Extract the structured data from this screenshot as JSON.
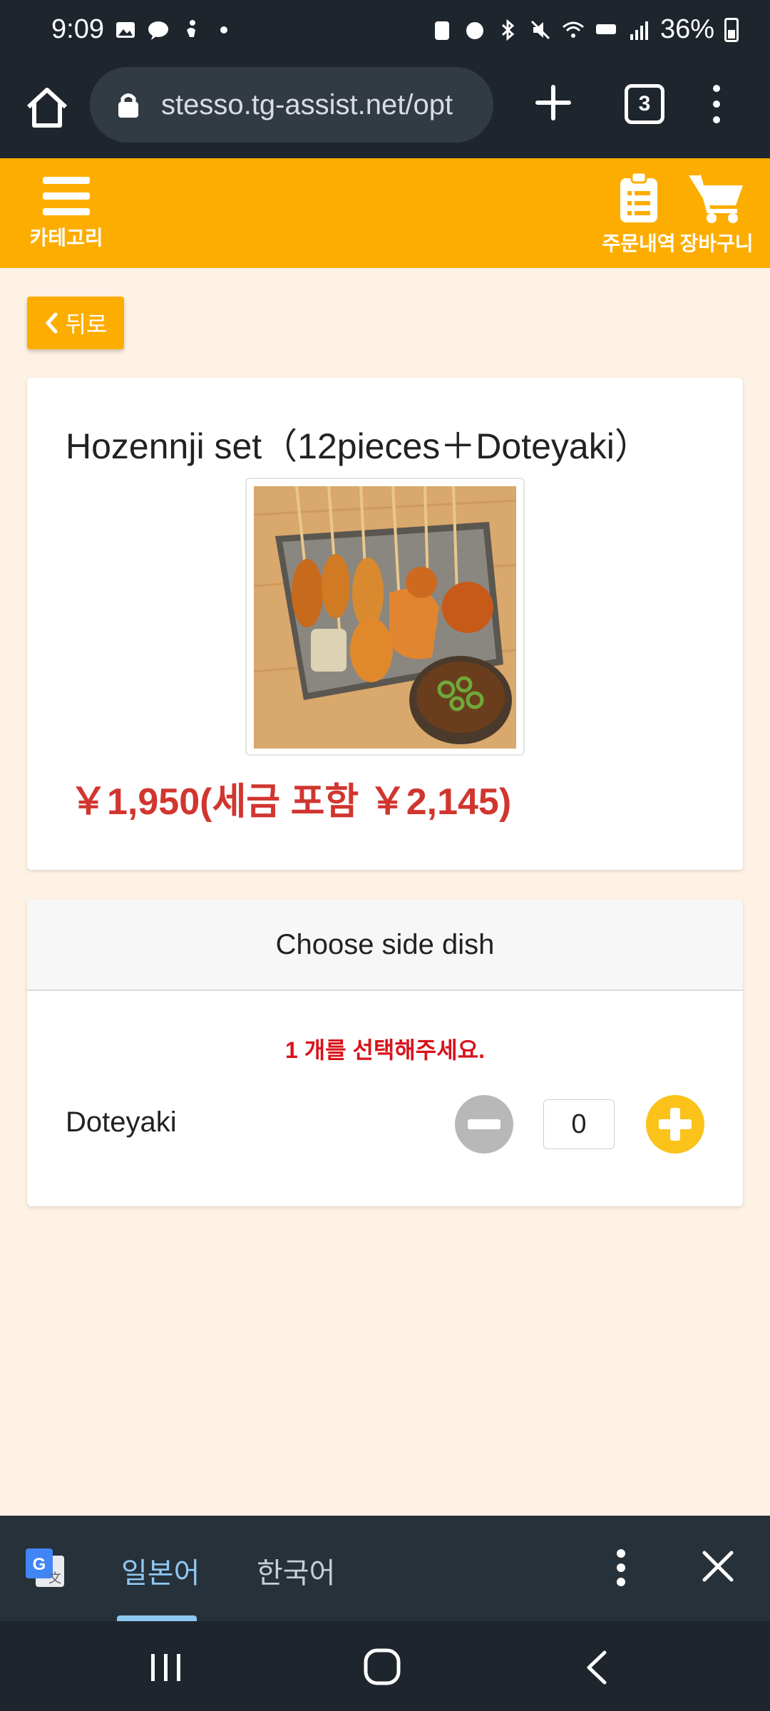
{
  "status_bar": {
    "time": "9:09",
    "battery": "36%"
  },
  "browser": {
    "url": "stesso.tg-assist.net/opt",
    "tab_count": "3"
  },
  "header": {
    "category_label": "카테고리",
    "orders_label": "주문내역",
    "cart_label": "장바구니"
  },
  "back_button": {
    "label": "뒤로"
  },
  "product": {
    "title": "Hozennji set（12pieces＋Doteyaki）",
    "price": "￥1,950(세금 포함 ￥2,145)"
  },
  "side_dish": {
    "header": "Choose side dish",
    "hint": "1 개를 선택해주세요.",
    "item_name": "Doteyaki",
    "quantity": "0"
  },
  "translate_bar": {
    "source_lang": "일본어",
    "target_lang": "한국어"
  },
  "colors": {
    "accent": "#fdad00",
    "price": "#d0362f",
    "hint": "#d8131b",
    "plus": "#fbc21a",
    "page_bg": "#fdf2e4"
  }
}
